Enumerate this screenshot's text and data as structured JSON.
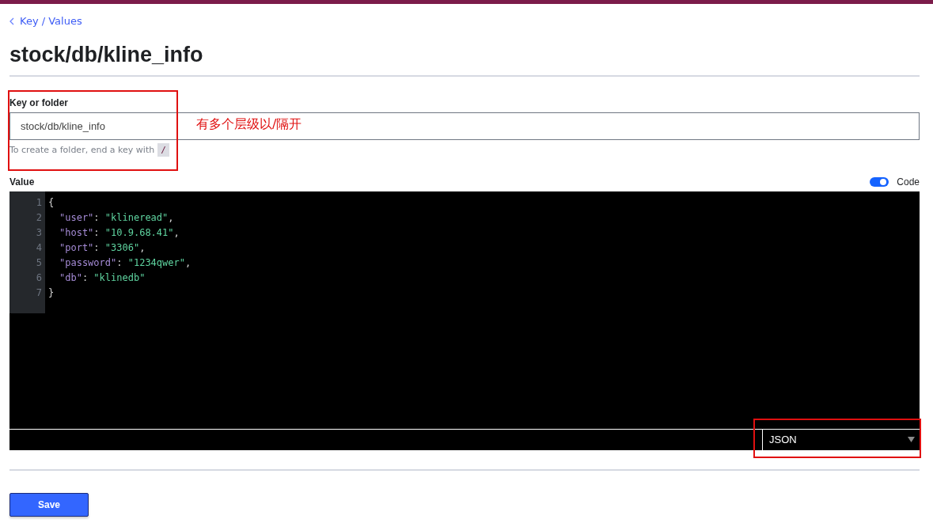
{
  "breadcrumb": {
    "label": "Key / Values"
  },
  "title": "stock/db/kline_info",
  "key_field": {
    "label": "Key or folder",
    "value": "stock/db/kline_info",
    "help": "To create a folder, end a key with",
    "help_code": "/"
  },
  "annotation": {
    "text": "有多个层级以/隔开"
  },
  "value_field": {
    "label": "Value",
    "code_toggle": {
      "label": "Code",
      "on": true
    },
    "lines": [
      {
        "number": "1",
        "indented": false,
        "tokens": [
          {
            "kind": "punct",
            "text": "{"
          }
        ]
      },
      {
        "number": "2",
        "indented": true,
        "tokens": [
          {
            "kind": "key",
            "text": "\"user\""
          },
          {
            "kind": "punct",
            "text": ": "
          },
          {
            "kind": "string",
            "text": "\"klineread\""
          },
          {
            "kind": "punct",
            "text": ","
          }
        ]
      },
      {
        "number": "3",
        "indented": true,
        "tokens": [
          {
            "kind": "key",
            "text": "\"host\""
          },
          {
            "kind": "punct",
            "text": ": "
          },
          {
            "kind": "string",
            "text": "\"10.9.68.41\""
          },
          {
            "kind": "punct",
            "text": ","
          }
        ]
      },
      {
        "number": "4",
        "indented": true,
        "tokens": [
          {
            "kind": "key",
            "text": "\"port\""
          },
          {
            "kind": "punct",
            "text": ": "
          },
          {
            "kind": "string",
            "text": "\"3306\""
          },
          {
            "kind": "punct",
            "text": ","
          }
        ]
      },
      {
        "number": "5",
        "indented": true,
        "tokens": [
          {
            "kind": "key",
            "text": "\"password\""
          },
          {
            "kind": "punct",
            "text": ": "
          },
          {
            "kind": "string",
            "text": "\"1234qwer\""
          },
          {
            "kind": "punct",
            "text": ","
          }
        ]
      },
      {
        "number": "6",
        "indented": true,
        "tokens": [
          {
            "kind": "key",
            "text": "\"db\""
          },
          {
            "kind": "punct",
            "text": ": "
          },
          {
            "kind": "string",
            "text": "\"klinedb\""
          }
        ]
      },
      {
        "number": "7",
        "indented": false,
        "tokens": [
          {
            "kind": "punct",
            "text": "}"
          }
        ]
      }
    ],
    "mode_select": {
      "value": "JSON"
    }
  },
  "save_button": {
    "label": "Save"
  }
}
